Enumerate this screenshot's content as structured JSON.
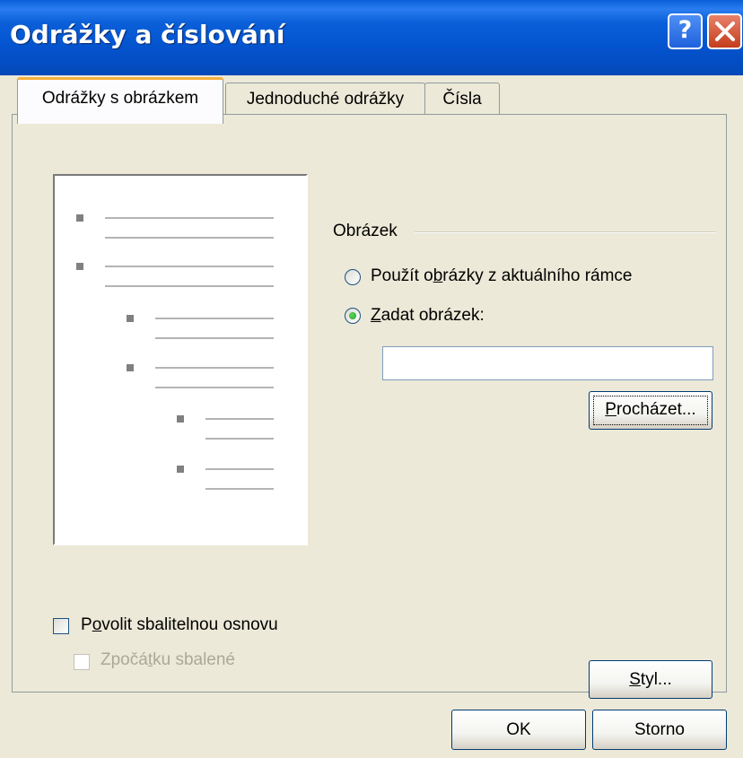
{
  "window": {
    "title": "Odrážky a číslování",
    "help_label": "?",
    "close_icon": "close-icon"
  },
  "tabs": [
    {
      "label": "Odrážky s obrázkem",
      "active": true
    },
    {
      "label": "Jednoduché odrážky",
      "active": false
    },
    {
      "label": "Čísla",
      "active": false
    }
  ],
  "picture_group": {
    "label": "Obrázek",
    "option_frame": {
      "label_pre": "Použít o",
      "label_key": "b",
      "label_post": "rázky z aktuálního rámce",
      "checked": false
    },
    "option_specify": {
      "label_pre": "",
      "label_key": "Z",
      "label_post": "adat obrázek:",
      "checked": true
    },
    "path_value": "",
    "browse_label_key": "P",
    "browse_label_post": "rocházet..."
  },
  "outline": {
    "enable_pre": "P",
    "enable_key": "o",
    "enable_post": "volit sbalitelnou osnovu",
    "enable_checked": false,
    "collapsed_pre": "Zpočá",
    "collapsed_key": "t",
    "collapsed_post": "ku sbalené",
    "collapsed_checked": false,
    "collapsed_disabled": true
  },
  "style_button": {
    "key": "S",
    "post": "tyl..."
  },
  "footer": {
    "ok": "OK",
    "cancel": "Storno"
  },
  "colors": {
    "titlebar": "#0a5fd8",
    "dialog_bg": "#ece9d8",
    "active_tab_accent": "#f7b03c"
  }
}
